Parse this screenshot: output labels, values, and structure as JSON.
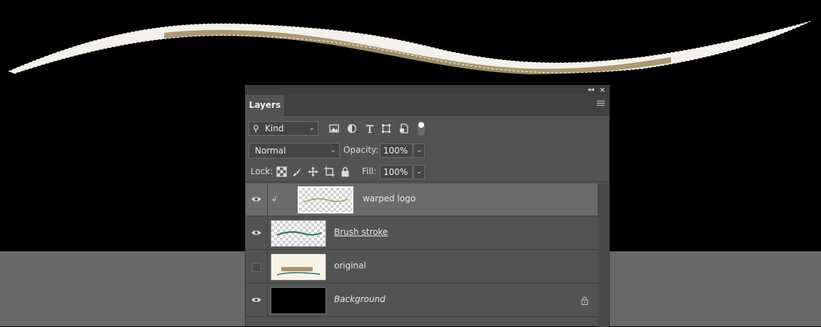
{
  "panel": {
    "tab_label": "Layers",
    "filter": {
      "kind_label": "Kind"
    },
    "blend_mode": "Normal",
    "opacity_label": "Opacity:",
    "opacity_value": "100%",
    "lock_label": "Lock:",
    "fill_label": "Fill:",
    "fill_value": "100%"
  },
  "layers": [
    {
      "name": "warped logo",
      "visible": true,
      "selected": true,
      "clipped": true
    },
    {
      "name": "Brush stroke",
      "visible": true,
      "selected": false
    },
    {
      "name": "original",
      "visible": false,
      "selected": false
    },
    {
      "name": "Background",
      "visible": true,
      "selected": false,
      "locked": true
    }
  ],
  "colors": {
    "canvas_dark": "#000000",
    "canvas_gray": "#686868",
    "panel_bg": "#535353",
    "selected_layer": "#6b6b6b",
    "logo_tan": "#a8946a"
  }
}
